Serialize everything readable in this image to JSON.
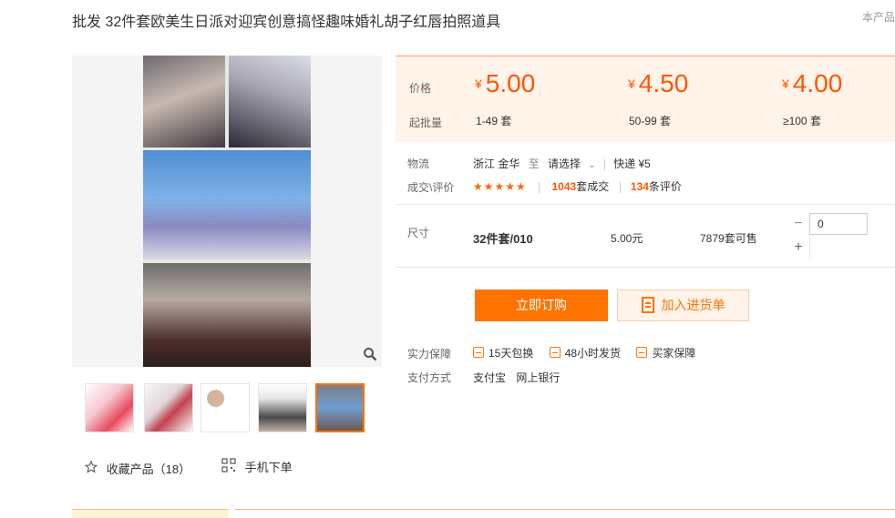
{
  "header": {
    "title": "批发 32件套欧美生日派对迎宾创意搞怪趣味婚礼胡子红唇拍照道具",
    "right_link": "本产品"
  },
  "gallery": {
    "zoom_icon": "magnifier-icon",
    "thumb_count": 5,
    "active_thumb_index": 4
  },
  "actions": {
    "favorite_label": "收藏产品（18）",
    "mobile_order_label": "手机下单"
  },
  "price": {
    "price_label": "价格",
    "qty_label": "起批量",
    "currency": "¥",
    "tiers": [
      {
        "price": "5.00",
        "range": "1-49 套"
      },
      {
        "price": "4.50",
        "range": "50-99 套"
      },
      {
        "price": "4.00",
        "range": "≥100 套"
      }
    ]
  },
  "logistics": {
    "label": "物流",
    "origin": "浙江 金华",
    "to": "至",
    "destination": "请选择",
    "shipping": "快递 ¥5"
  },
  "trade": {
    "label": "成交\\评价",
    "stars": "★★★★★",
    "deals_count": "1043",
    "deals_suffix": "套成交",
    "reviews_count": "134",
    "reviews_suffix": "条评价"
  },
  "sku": {
    "label": "尺寸",
    "name": "32件套/010",
    "price": "5.00元",
    "stock": "7879套可售",
    "quantity": "0"
  },
  "buttons": {
    "buy": "立即订购",
    "cart": "加入进货单"
  },
  "guarantee": {
    "label": "实力保障",
    "items": [
      "15天包换",
      "48小时发货",
      "买家保障"
    ]
  },
  "payment": {
    "label": "支付方式",
    "methods": [
      "支付宝",
      "网上银行"
    ]
  },
  "colors": {
    "accent": "#ff7300",
    "price": "#ff5500",
    "price_bg": "#fff3ea"
  }
}
